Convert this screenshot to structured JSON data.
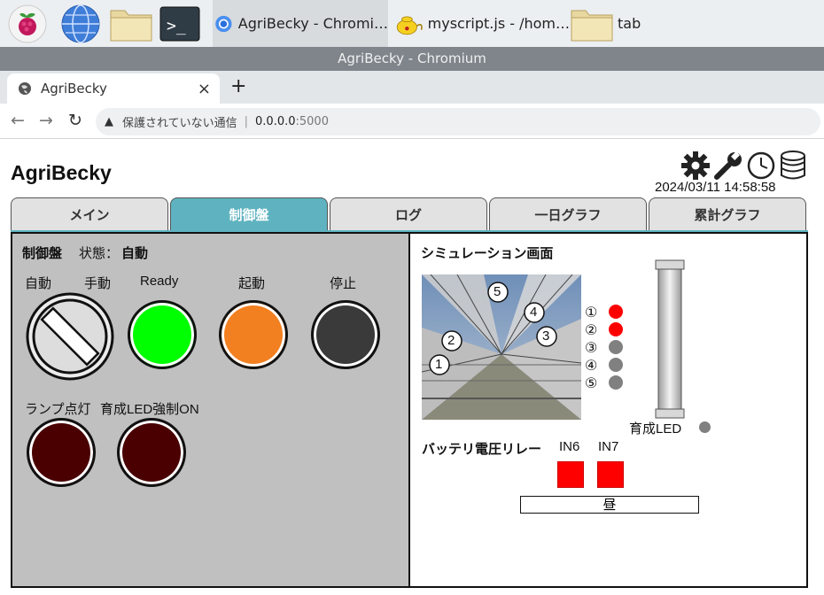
{
  "taskbar": {
    "apps": [
      {
        "name": "chromium-window",
        "label": "AgriBecky - Chromi…"
      },
      {
        "name": "thonny-window",
        "label": "myscript.js - /hom…"
      },
      {
        "name": "folder-window",
        "label": "tab"
      }
    ]
  },
  "window": {
    "title": "AgriBecky - Chromium"
  },
  "browser": {
    "tab_title": "AgriBecky",
    "tab_close": "×",
    "new_tab": "+",
    "back": "←",
    "forward": "→",
    "reload": "↻",
    "warn": "▲",
    "security_text": "保護されていない通信",
    "separator": "|",
    "url_host": "0.0.0.0",
    "url_port": ":5000"
  },
  "app": {
    "title": "AgriBecky",
    "datetime": "2024/03/11 14:58:58",
    "tabs": [
      "メイン",
      "制御盤",
      "ログ",
      "一日グラフ",
      "累計グラフ"
    ],
    "active_tab": 1
  },
  "control": {
    "heading": "制御盤",
    "status_label": "状態：",
    "status_value": "自動",
    "auto_label": "自動",
    "manual_label": "手動",
    "ready_label": "Ready",
    "start_label": "起動",
    "stop_label": "停止",
    "lamp_label": "ランプ点灯",
    "led_force_label": "育成LED強制ON"
  },
  "simulation": {
    "heading": "シミュレーション画面",
    "markers": [
      "5",
      "4",
      "3",
      "2",
      "1"
    ],
    "windows": [
      {
        "label": "①",
        "state": "red"
      },
      {
        "label": "②",
        "state": "red"
      },
      {
        "label": "③",
        "state": "gray"
      },
      {
        "label": "④",
        "state": "gray"
      },
      {
        "label": "⑤",
        "state": "gray"
      }
    ],
    "led_label": "育成LED",
    "battery_label": "バッテリ電圧リレー",
    "relays": [
      {
        "label": "IN6"
      },
      {
        "label": "IN7"
      }
    ],
    "day_label": "昼"
  },
  "colors": {
    "ready": "#00ff00",
    "start": "#f28020",
    "stop": "#3a3a3a",
    "lamp_off": "#4a0000",
    "on": "#ff0000",
    "off": "#808080",
    "tab_active": "#5fb3c0"
  }
}
